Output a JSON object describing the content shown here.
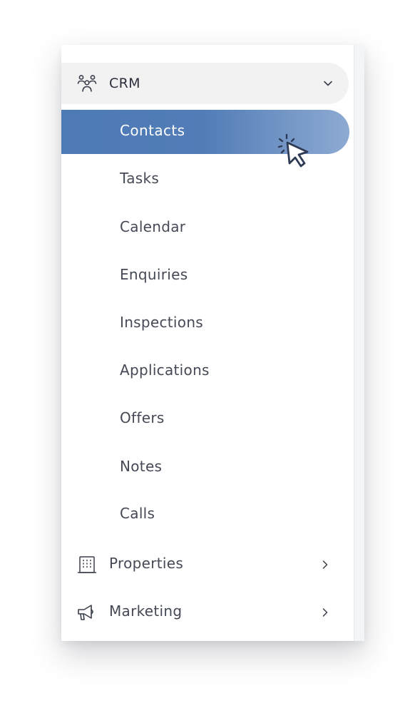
{
  "sidebar": {
    "crm": {
      "label": "CRM",
      "icon": "people-group-icon",
      "expanded": true
    },
    "active_item": {
      "label": "Contacts"
    },
    "sub_items": [
      {
        "label": "Tasks"
      },
      {
        "label": "Calendar"
      },
      {
        "label": "Enquiries"
      },
      {
        "label": "Inspections"
      },
      {
        "label": "Applications"
      },
      {
        "label": "Offers"
      },
      {
        "label": "Notes"
      },
      {
        "label": "Calls"
      }
    ],
    "sections": [
      {
        "label": "Properties",
        "icon": "building-icon"
      },
      {
        "label": "Marketing",
        "icon": "megaphone-icon"
      }
    ]
  },
  "colors": {
    "accent_start": "#4d79b5",
    "accent_end": "#8daad2",
    "header_bg": "#f2f2f3",
    "text": "#444955",
    "cursor_stroke": "#2f3b55"
  }
}
